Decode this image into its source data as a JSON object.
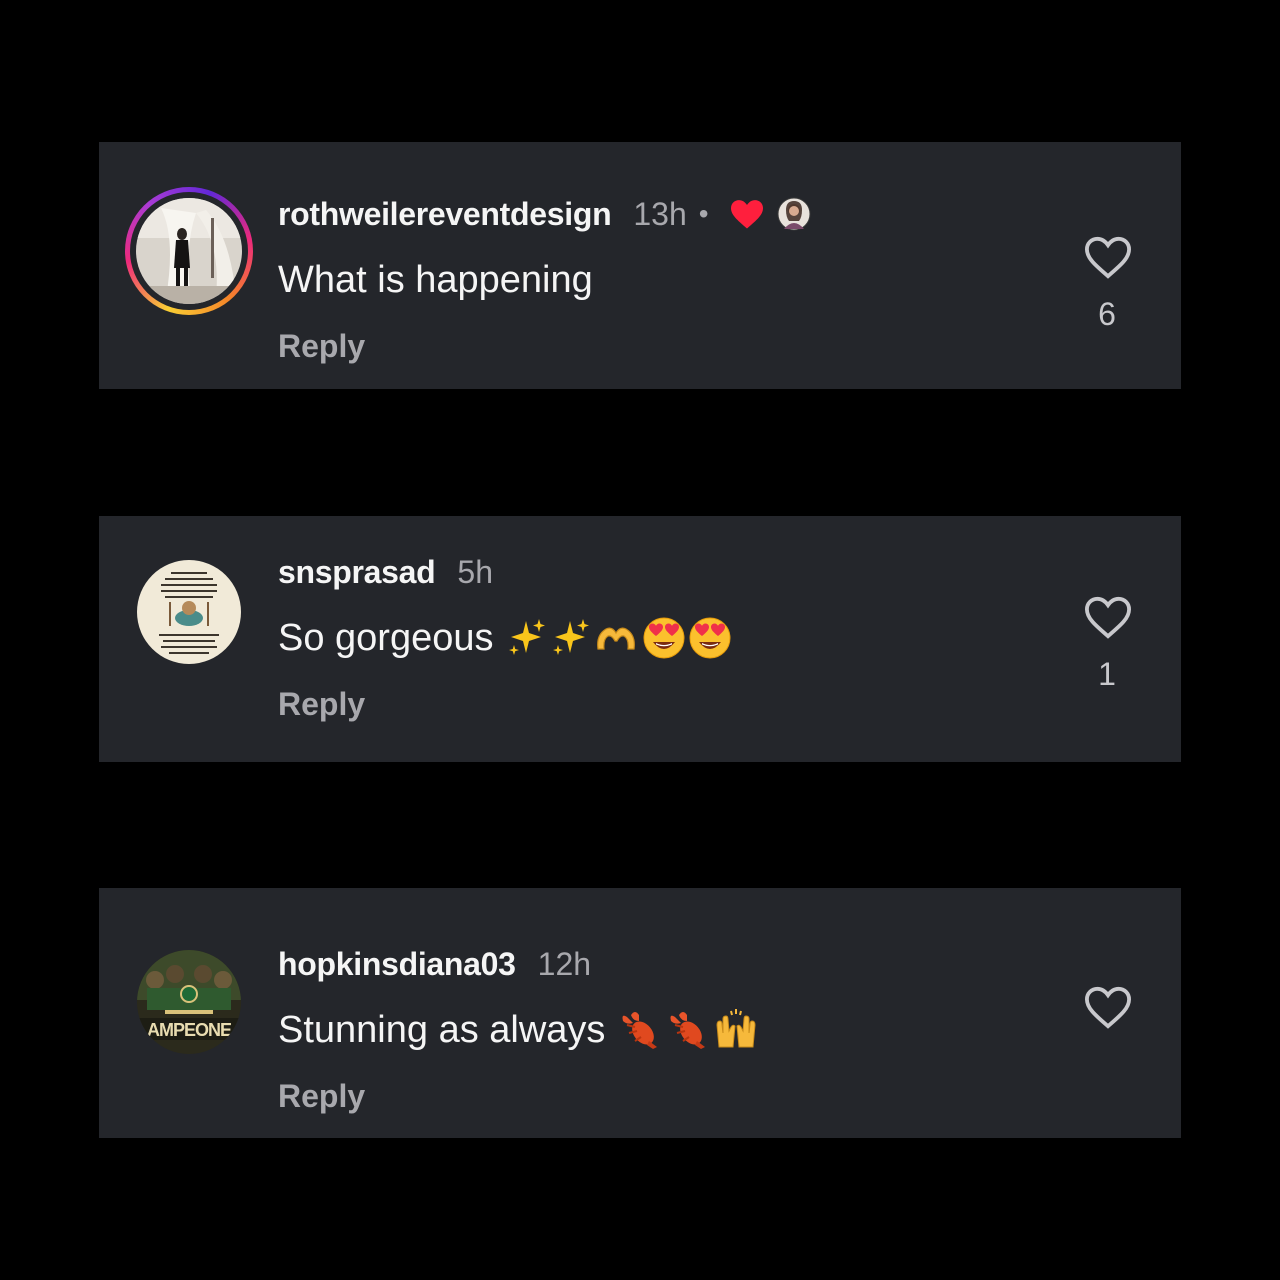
{
  "colors": {
    "background": "#000000",
    "card": "#24262b",
    "text_primary": "#f5f5f5",
    "text_secondary": "#a8a8ad",
    "heart_red": "#ff1f3d"
  },
  "comments": [
    {
      "username": "rothweilereventdesign",
      "time": "13h",
      "separator": "•",
      "author_liked": true,
      "avatar_icon": "wedding-photo-avatar",
      "has_story_ring": true,
      "text": "What is happening",
      "emojis": [],
      "reply_label": "Reply",
      "like_count": "6"
    },
    {
      "username": "snsprasad",
      "time": "5h",
      "avatar_icon": "quote-poster-avatar",
      "has_story_ring": false,
      "text": "So gorgeous",
      "emojis": [
        "sparkles-icon",
        "sparkles-icon",
        "heart-hands-icon",
        "heart-eyes-icon",
        "heart-eyes-icon"
      ],
      "reply_label": "Reply",
      "like_count": "1"
    },
    {
      "username": "hopkinsdiana03",
      "time": "12h",
      "avatar_icon": "celtics-poster-avatar",
      "has_story_ring": false,
      "text": "Stunning as always",
      "emojis": [
        "lobster-icon",
        "lobster-icon",
        "raised-hands-icon"
      ],
      "reply_label": "Reply",
      "like_count": ""
    }
  ]
}
